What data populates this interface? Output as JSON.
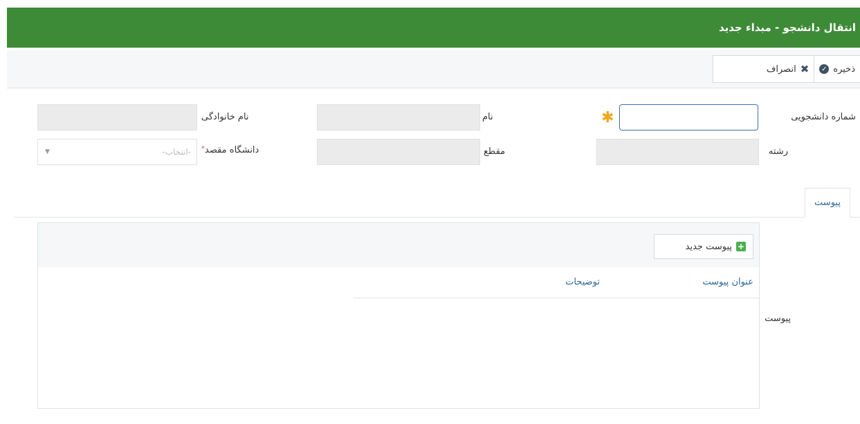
{
  "header": {
    "title": "انتقال دانشجو - مبداء جدید"
  },
  "toolbar": {
    "save_label": "ذخیره",
    "cancel_label": "انصراف"
  },
  "form": {
    "student_number_label": "شماره دانشجویی",
    "student_number_value": "",
    "first_name_label": "نام",
    "last_name_label": "نام خانوادگی",
    "major_label": "رشته",
    "degree_label": "مقطع",
    "destination_university_label": "دانشگاه مقصد",
    "destination_university_placeholder": "-انتخاب-"
  },
  "tabs": [
    {
      "label": "پیوست"
    }
  ],
  "attachments": {
    "section_label": "پیوست",
    "add_button_label": "پیوست جدید",
    "columns": [
      "عنوان پیوست",
      "توضیحات"
    ],
    "rows": []
  },
  "colors": {
    "header": "#3d8b37",
    "link": "#2a6496",
    "required": "#f0a81d"
  }
}
